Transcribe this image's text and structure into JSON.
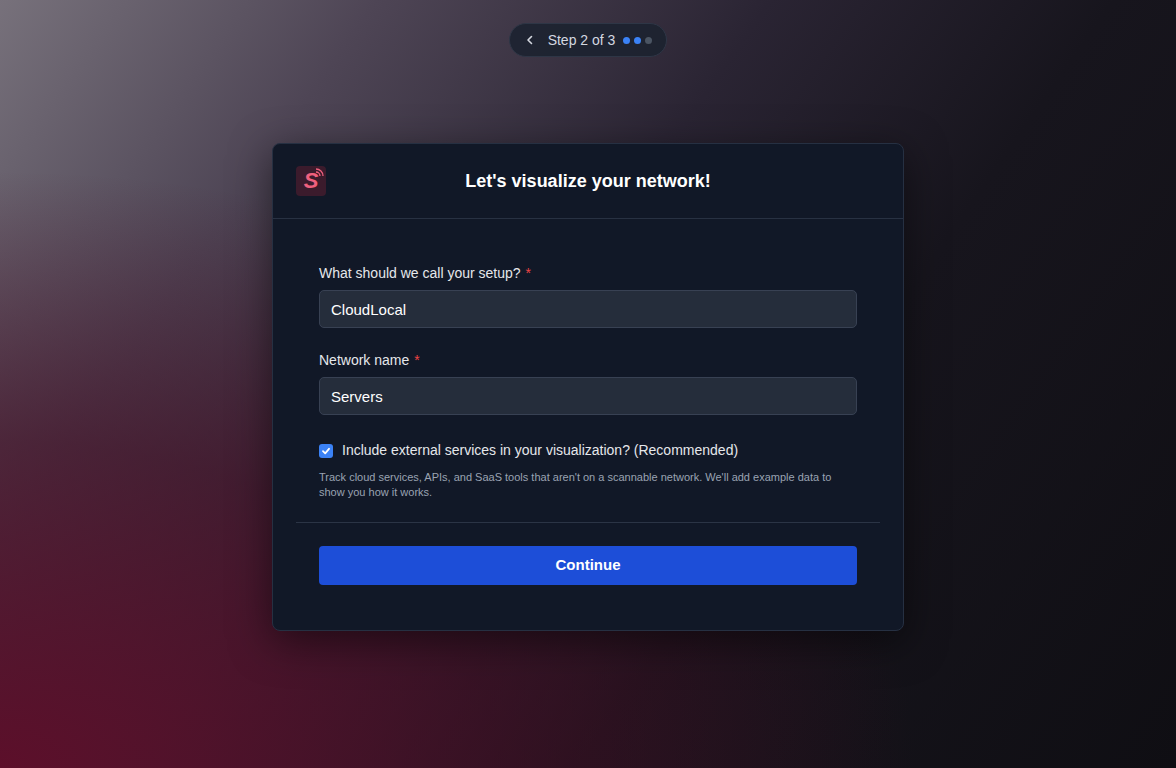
{
  "step": {
    "label": "Step 2 of 3",
    "dots": [
      {
        "active": true
      },
      {
        "active": true
      },
      {
        "active": false
      }
    ]
  },
  "card": {
    "logo": "S",
    "title": "Let's visualize your network!"
  },
  "fields": [
    {
      "label": "What should we call your setup?",
      "required": true,
      "required_mark": "*",
      "value": "CloudLocal"
    },
    {
      "label": "Network name",
      "required": true,
      "required_mark": "*",
      "value": "Servers"
    }
  ],
  "checkbox": {
    "label": "Include external services in your visualization? (Recommended)",
    "checked": true,
    "description": "Track cloud services, APIs, and SaaS tools that aren't on a scannable network. We'll add example data to show you how it works."
  },
  "button": {
    "label": "Continue"
  }
}
